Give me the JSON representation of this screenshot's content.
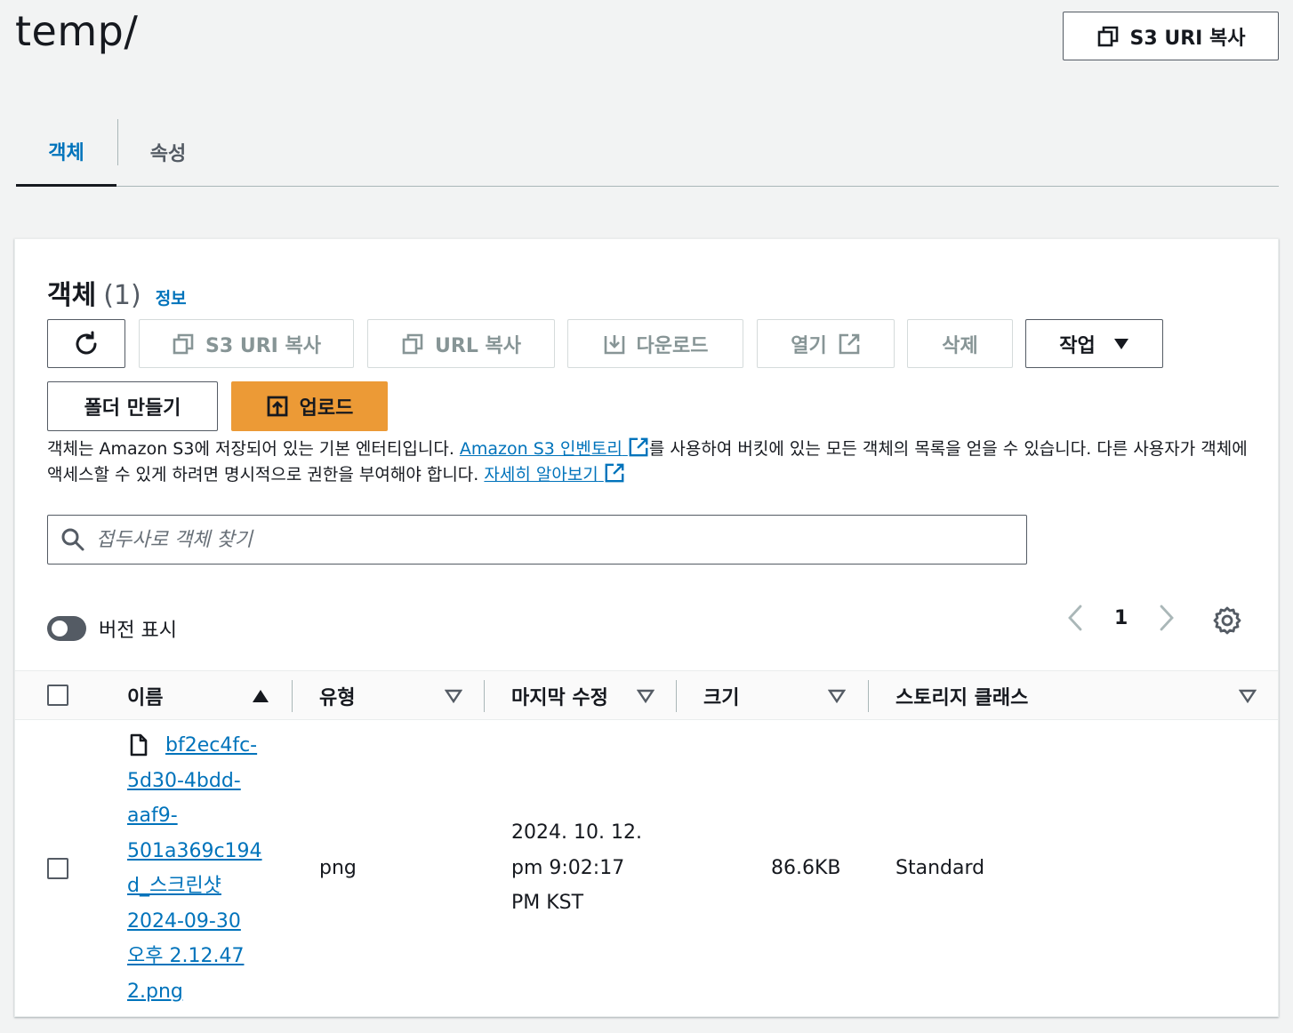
{
  "page": {
    "title": "temp/",
    "copy_s3_uri_label": "S3 URI 복사"
  },
  "tabs": [
    {
      "label": "객체",
      "active": true
    },
    {
      "label": "속성",
      "active": false
    }
  ],
  "panel": {
    "title": "객체",
    "count": "(1)",
    "info_link": "정보",
    "toolbar": {
      "refresh": "refresh-icon",
      "copy_s3_uri": "S3 URI 복사",
      "copy_url": "URL 복사",
      "download": "다운로드",
      "open": "열기",
      "delete": "삭제",
      "actions": "작업",
      "create_folder": "폴더 만들기",
      "upload": "업로드"
    },
    "description": {
      "part1": "객체는 Amazon S3에 저장되어 있는 기본 엔터티입니다.",
      "link1": "Amazon S3 인벤토리",
      "part2": "를 사용하여 버킷에 있는 모든 객체의 목록을 얻을 수 있습니다. 다른 사용자가 객체에 액세스할 수 있게 하려면 명시적으로 권한을 부여해야 합니다.",
      "link2": "자세히 알아보기"
    },
    "search": {
      "placeholder": "접두사로 객체 찾기",
      "value": ""
    },
    "show_versions": {
      "label": "버전 표시",
      "enabled": false
    },
    "pagination": {
      "current_page": "1"
    },
    "table": {
      "columns": [
        "이름",
        "유형",
        "마지막 수정",
        "크기",
        "스토리지 클래스"
      ],
      "rows": [
        {
          "name_lines": [
            "bf2ec4fc-",
            "5d30-4bdd-",
            "aaf9-",
            "501a369c194",
            "d_스크린샷",
            "2024-09-30",
            "오후 2.12.47",
            "2.png"
          ],
          "type": "png",
          "modified_lines": [
            "2024. 10. 12.",
            "pm 9:02:17",
            "PM KST"
          ],
          "size": "86.6KB",
          "storage_class": "Standard"
        }
      ]
    }
  },
  "colors": {
    "accent": "#0073bb",
    "primary_button": "#ec9a36",
    "border": "#545b64",
    "disabled": "#879596"
  }
}
